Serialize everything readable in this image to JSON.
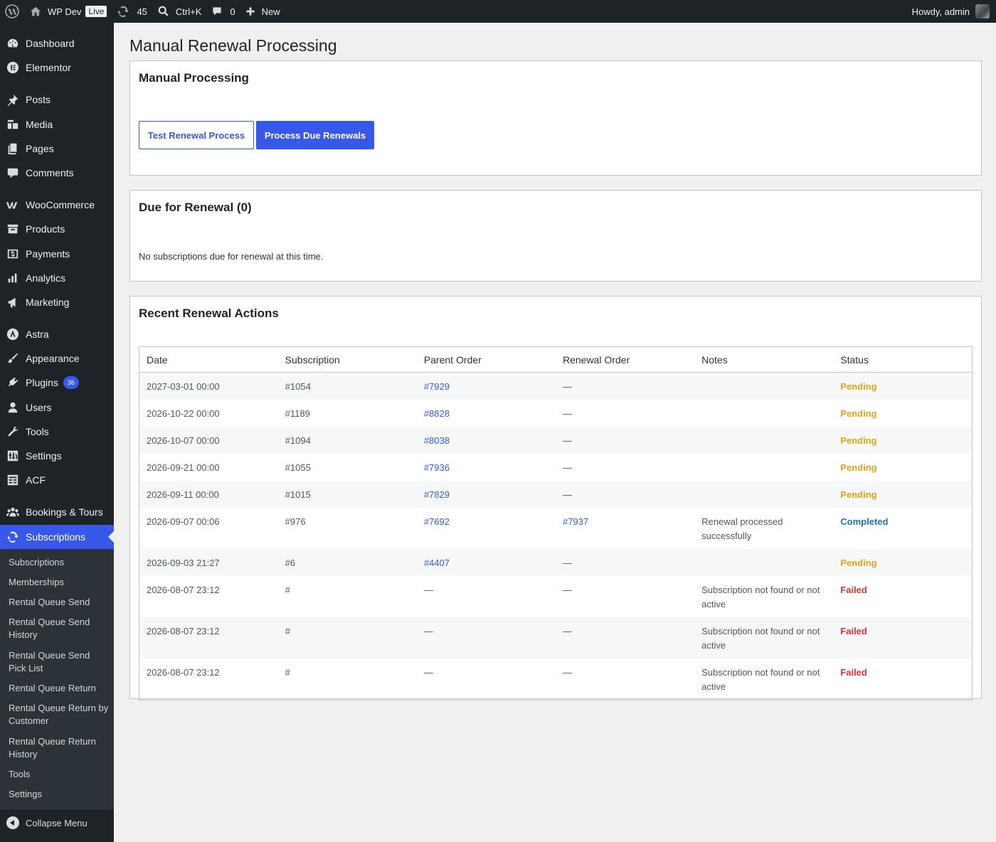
{
  "adminbar": {
    "site_name": "WP Dev",
    "live_badge": "Live",
    "updates_count": "45",
    "search_shortcut": "Ctrl+K",
    "comments_count": "0",
    "new_label": "New",
    "howdy": "Howdy, admin"
  },
  "sidebar": {
    "items": [
      {
        "label": "Dashboard",
        "icon": "dashboard-icon"
      },
      {
        "label": "Elementor",
        "icon": "elementor-icon"
      },
      {
        "label": "Posts",
        "icon": "pin-icon"
      },
      {
        "label": "Media",
        "icon": "media-icon"
      },
      {
        "label": "Pages",
        "icon": "pages-icon"
      },
      {
        "label": "Comments",
        "icon": "comment-icon"
      },
      {
        "label": "WooCommerce",
        "icon": "woo-icon"
      },
      {
        "label": "Products",
        "icon": "archive-icon"
      },
      {
        "label": "Payments",
        "icon": "payments-icon"
      },
      {
        "label": "Analytics",
        "icon": "bar-chart-icon"
      },
      {
        "label": "Marketing",
        "icon": "megaphone-icon"
      },
      {
        "label": "Astra",
        "icon": "astra-icon"
      },
      {
        "label": "Appearance",
        "icon": "brush-icon"
      },
      {
        "label": "Plugins",
        "icon": "plugin-icon",
        "badge": "36"
      },
      {
        "label": "Users",
        "icon": "user-icon"
      },
      {
        "label": "Tools",
        "icon": "wrench-icon"
      },
      {
        "label": "Settings",
        "icon": "sliders-icon"
      },
      {
        "label": "ACF",
        "icon": "acf-icon"
      },
      {
        "label": "Bookings & Tours",
        "icon": "groups-icon"
      },
      {
        "label": "Subscriptions",
        "icon": "update-icon",
        "current": true
      }
    ],
    "submenu": [
      "Subscriptions",
      "Memberships",
      "Rental Queue Send",
      "Rental Queue Send History",
      "Rental Queue Send Pick List",
      "Rental Queue Return",
      "Rental Queue Return by Customer",
      "Rental Queue Return History",
      "Tools",
      "Settings"
    ],
    "collapse_label": "Collapse Menu"
  },
  "page": {
    "title": "Manual Renewal Processing",
    "manual": {
      "heading": "Manual Processing",
      "test_button": "Test Renewal Process",
      "process_button": "Process Due Renewals"
    },
    "due": {
      "heading": "Due for Renewal (0)",
      "empty_message": "No subscriptions due for renewal at this time."
    },
    "recent": {
      "heading": "Recent Renewal Actions",
      "columns": [
        "Date",
        "Subscription",
        "Parent Order",
        "Renewal Order",
        "Notes",
        "Status"
      ],
      "rows": [
        {
          "date": "2027-03-01 00:00",
          "subscription": "#1054",
          "parent": "#7929",
          "renewal": "—",
          "notes": "",
          "status": "Pending"
        },
        {
          "date": "2026-10-22 00:00",
          "subscription": "#1189",
          "parent": "#8828",
          "renewal": "—",
          "notes": "",
          "status": "Pending"
        },
        {
          "date": "2026-10-07 00:00",
          "subscription": "#1094",
          "parent": "#8038",
          "renewal": "—",
          "notes": "",
          "status": "Pending"
        },
        {
          "date": "2026-09-21 00:00",
          "subscription": "#1055",
          "parent": "#7936",
          "renewal": "—",
          "notes": "",
          "status": "Pending"
        },
        {
          "date": "2026-09-11 00:00",
          "subscription": "#1015",
          "parent": "#7829",
          "renewal": "—",
          "notes": "",
          "status": "Pending"
        },
        {
          "date": "2026-09-07 00:06",
          "subscription": "#976",
          "parent": "#7692",
          "renewal": "#7937",
          "notes": "Renewal processed successfully",
          "status": "Completed"
        },
        {
          "date": "2026-09-03 21:27",
          "subscription": "#6",
          "parent": "#4407",
          "renewal": "—",
          "notes": "",
          "status": "Pending"
        },
        {
          "date": "2026-08-07 23:12",
          "subscription": "#",
          "parent": "—",
          "renewal": "—",
          "notes": "Subscription not found or not active",
          "status": "Failed"
        },
        {
          "date": "2026-08-07 23:12",
          "subscription": "#",
          "parent": "—",
          "renewal": "—",
          "notes": "Subscription not found or not active",
          "status": "Failed"
        },
        {
          "date": "2026-08-07 23:12",
          "subscription": "#",
          "parent": "—",
          "renewal": "—",
          "notes": "Subscription not found or not active",
          "status": "Failed"
        }
      ]
    }
  },
  "colors": {
    "accent": "#3858e9",
    "pending": "#dba617",
    "completed": "#2271b1",
    "failed": "#d63638",
    "sidebar_bg": "#1d2327"
  }
}
